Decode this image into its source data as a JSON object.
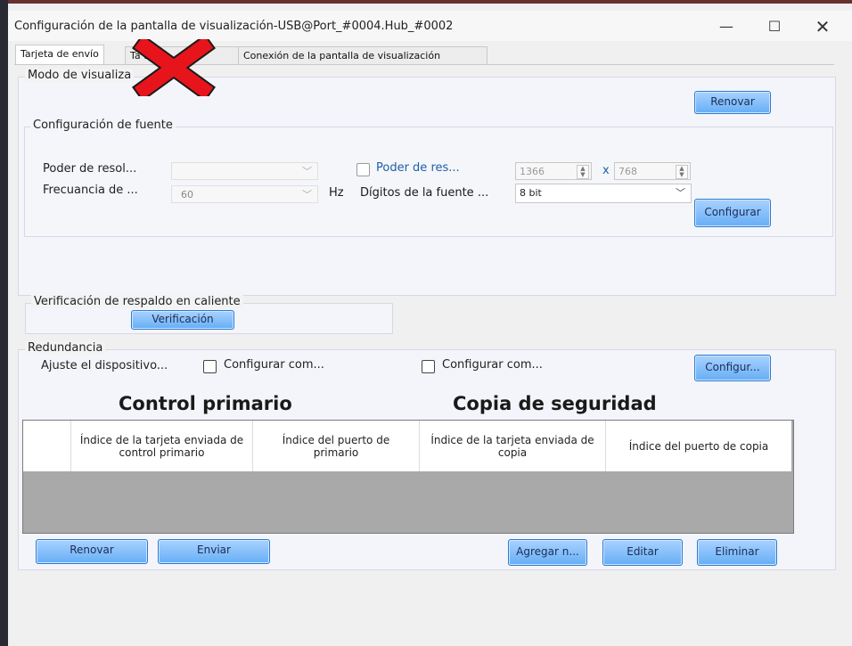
{
  "window": {
    "title": "Configuración de la pantalla de visualización-USB@Port_#0004.Hub_#0002",
    "controls": {
      "minimize": "—",
      "maximize": "☐",
      "close": "✕"
    }
  },
  "tabs": [
    {
      "label": "Tarjeta de envío"
    },
    {
      "label": "Ta                tora"
    },
    {
      "label": "Conexión de la pantalla de visualización"
    }
  ],
  "modo": {
    "legend": "Modo de visualiza",
    "renovar_label": "Renovar",
    "fuente": {
      "legend": "Configuración de fuente",
      "poder_label": "Poder de resol...",
      "poder_value": "",
      "poder_res_label": "Poder de res...",
      "width": "1366",
      "x": "x",
      "height": "768",
      "frecuencia_label": "Frecuancia de ...",
      "frecuencia_value": "60",
      "hz": "Hz",
      "digitos_label": "Dígitos de la fuente ...",
      "digitos_value": "8 bit",
      "configurar_label": "Configurar"
    }
  },
  "verificacion": {
    "legend": "Verificación de respaldo en caliente",
    "button_label": "Verificación"
  },
  "redundancia": {
    "legend": "Redundancia",
    "ajuste_label": "Ajuste el dispositivo...",
    "cfg1_label": "Configurar com...",
    "cfg2_label": "Configurar com...",
    "configur_label": "Configur...",
    "head_primario": "Control primario",
    "head_copia": "Copia de seguridad",
    "columns": [
      "",
      "Índice de la tarjeta enviada de control primario",
      "Índice del puerto de primario",
      "Índice de la tarjeta enviada de copia",
      "Índice del puerto de copia"
    ],
    "buttons": {
      "renovar": "Renovar",
      "enviar": "Enviar",
      "agregar": "Agregar n...",
      "editar": "Editar",
      "eliminar": "Eliminar"
    }
  },
  "colors": {
    "accent_button": "#66aef5",
    "overlay_x": "#e8141b",
    "table_empty": "#a9a9a9"
  }
}
